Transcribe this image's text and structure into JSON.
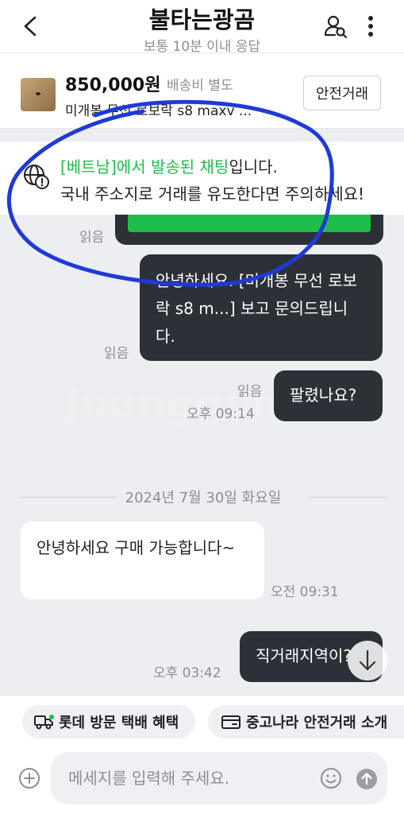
{
  "header": {
    "title": "불타는광곰",
    "subtitle": "보통 10분 이내 응답"
  },
  "product": {
    "price": "850,000원",
    "shipping": "배송비 별도",
    "name": "미개봉 무선 로보락 s8 maxv ...",
    "safe_trade_label": "안전거래"
  },
  "warning": {
    "highlight": "[베트남]에서 발송된 채팅",
    "line1_suffix": "입니다.",
    "line2": "국내 주소지로 거래를 유도한다면 주의하세요!"
  },
  "messages": [
    {
      "direction": "out",
      "text": "",
      "read": "읽음"
    },
    {
      "direction": "out",
      "text": "안녕하세요. [미개봉 무선 로보락 s8 m...] 보고 문의드립니다.",
      "read": "읽음"
    },
    {
      "direction": "out",
      "text": "팔렸나요?",
      "read": "읽음",
      "time": "오후 09:14"
    },
    {
      "direction": "in",
      "text": "안녕하세요 구매 가능합니다~",
      "time": "오전 09:31"
    },
    {
      "direction": "out",
      "text": "직거래지역이?",
      "time": "오후 03:42"
    }
  ],
  "date_divider": "2024년 7월 30일 화요일",
  "watermark": "Joonggonara",
  "quick_actions": [
    {
      "label": "롯데 방문 택배 혜택",
      "icon": "truck-icon"
    },
    {
      "label": "중고나라 안전거래 소개",
      "icon": "card-icon"
    }
  ],
  "composer": {
    "placeholder": "메세지를 입력해 주세요."
  },
  "colors": {
    "accent_green": "#1fbd4a",
    "bubble_dark": "#2c3138",
    "background": "#eceef1",
    "annotation_blue": "#1f3ad8"
  }
}
